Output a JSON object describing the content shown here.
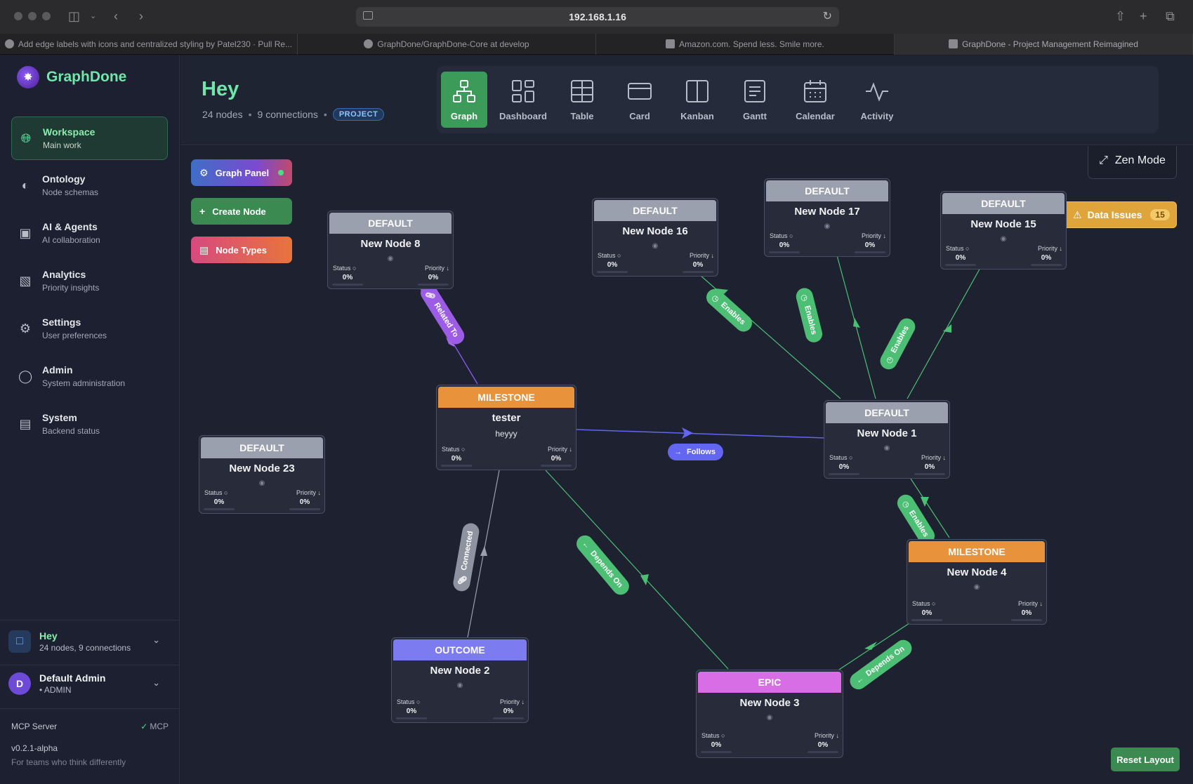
{
  "browser": {
    "url": "192.168.1.16",
    "tabs": [
      {
        "label": "Add edge labels with icons and centralized styling by Patel230 · Pull Re..."
      },
      {
        "label": "GraphDone/GraphDone-Core at develop"
      },
      {
        "label": "Amazon.com. Spend less. Smile more."
      },
      {
        "label": "GraphDone - Project Management Reimagined"
      }
    ]
  },
  "sidebar": {
    "brand": "GraphDone",
    "items": [
      {
        "title": "Workspace",
        "sub": "Main work",
        "icon": "globe-icon"
      },
      {
        "title": "Ontology",
        "sub": "Node schemas",
        "icon": "schema-icon"
      },
      {
        "title": "AI & Agents",
        "sub": "AI collaboration",
        "icon": "robot-icon"
      },
      {
        "title": "Analytics",
        "sub": "Priority insights",
        "icon": "bar-chart-icon"
      },
      {
        "title": "Settings",
        "sub": "User preferences",
        "icon": "gear-icon"
      },
      {
        "title": "Admin",
        "sub": "System administration",
        "icon": "shield-icon"
      },
      {
        "title": "System",
        "sub": "Backend status",
        "icon": "server-icon"
      }
    ],
    "project": {
      "name": "Hey",
      "sub": "24 nodes, 9 connections"
    },
    "user": {
      "initial": "D",
      "name": "Default Admin",
      "role": "• ADMIN"
    },
    "mcp": {
      "label": "MCP Server",
      "status": "MCP"
    },
    "version": "v0.2.1-alpha",
    "tagline": "For teams who think differently"
  },
  "header": {
    "title": "Hey",
    "nodes": "24 nodes",
    "connections": "9 connections",
    "badge": "PROJECT",
    "views": [
      {
        "label": "Graph",
        "icon": "graph-icon",
        "active": true
      },
      {
        "label": "Dashboard",
        "icon": "dashboard-icon",
        "active": false
      },
      {
        "label": "Table",
        "icon": "table-icon",
        "active": false
      },
      {
        "label": "Card",
        "icon": "card-icon",
        "active": false
      },
      {
        "label": "Kanban",
        "icon": "kanban-icon",
        "active": false
      },
      {
        "label": "Gantt",
        "icon": "gantt-icon",
        "active": false
      },
      {
        "label": "Calendar",
        "icon": "calendar-icon",
        "active": false
      },
      {
        "label": "Activity",
        "icon": "activity-icon",
        "active": false
      }
    ]
  },
  "canvas": {
    "tools": {
      "graph_panel": "Graph Panel",
      "create_node": "Create Node",
      "node_types": "Node Types"
    },
    "zen_mode": "Zen Mode",
    "data_issues": {
      "label": "Data Issues",
      "count": "15"
    },
    "reset_layout": "Reset Layout"
  },
  "node_labels": {
    "status": "Status",
    "priority": "Priority"
  },
  "colors": {
    "default": "#9aa0ad",
    "milestone": "#e8923c",
    "outcome": "#7c7cf0",
    "epic": "#d86ee6",
    "enables": "#4cbf74",
    "depends_on": "#4cbf74",
    "related_to": "#a468e8",
    "follows": "#6366f1",
    "connected": "#9aa0ad",
    "accent": "#6ee7a8"
  },
  "nodes": [
    {
      "id": "n8",
      "type": "DEFAULT",
      "title": "New Node 8",
      "status": "0%",
      "priority": "0%"
    },
    {
      "id": "n16",
      "type": "DEFAULT",
      "title": "New Node 16",
      "status": "0%",
      "priority": "0%"
    },
    {
      "id": "n17",
      "type": "DEFAULT",
      "title": "New Node 17",
      "status": "0%",
      "priority": "0%"
    },
    {
      "id": "n15",
      "type": "DEFAULT",
      "title": "New Node 15",
      "status": "0%",
      "priority": "0%"
    },
    {
      "id": "tester",
      "type": "MILESTONE",
      "title": "tester",
      "desc": "heyyy",
      "status": "0%",
      "priority": "0%"
    },
    {
      "id": "n1",
      "type": "DEFAULT",
      "title": "New Node 1",
      "status": "0%",
      "priority": "0%"
    },
    {
      "id": "n23",
      "type": "DEFAULT",
      "title": "New Node 23",
      "status": "0%",
      "priority": "0%"
    },
    {
      "id": "n4",
      "type": "MILESTONE",
      "title": "New Node 4",
      "status": "0%",
      "priority": "0%"
    },
    {
      "id": "n2",
      "type": "OUTCOME",
      "title": "New Node 2",
      "status": "0%",
      "priority": "0%"
    },
    {
      "id": "n3",
      "type": "EPIC",
      "title": "New Node 3",
      "status": "0%",
      "priority": "0%"
    }
  ],
  "edges": [
    {
      "id": "e-related",
      "label": "Related To",
      "kind": "related_to"
    },
    {
      "id": "e-enables-16",
      "label": "Enables",
      "kind": "enables"
    },
    {
      "id": "e-enables-17",
      "label": "Enables",
      "kind": "enables"
    },
    {
      "id": "e-enables-15",
      "label": "Enables",
      "kind": "enables"
    },
    {
      "id": "e-follows",
      "label": "Follows",
      "kind": "follows"
    },
    {
      "id": "e-enables-4",
      "label": "Enables",
      "kind": "enables"
    },
    {
      "id": "e-connected",
      "label": "Connected",
      "kind": "connected"
    },
    {
      "id": "e-depends-tester",
      "label": "Depends On",
      "kind": "depends_on"
    },
    {
      "id": "e-depends-4",
      "label": "Depends On",
      "kind": "depends_on"
    }
  ]
}
